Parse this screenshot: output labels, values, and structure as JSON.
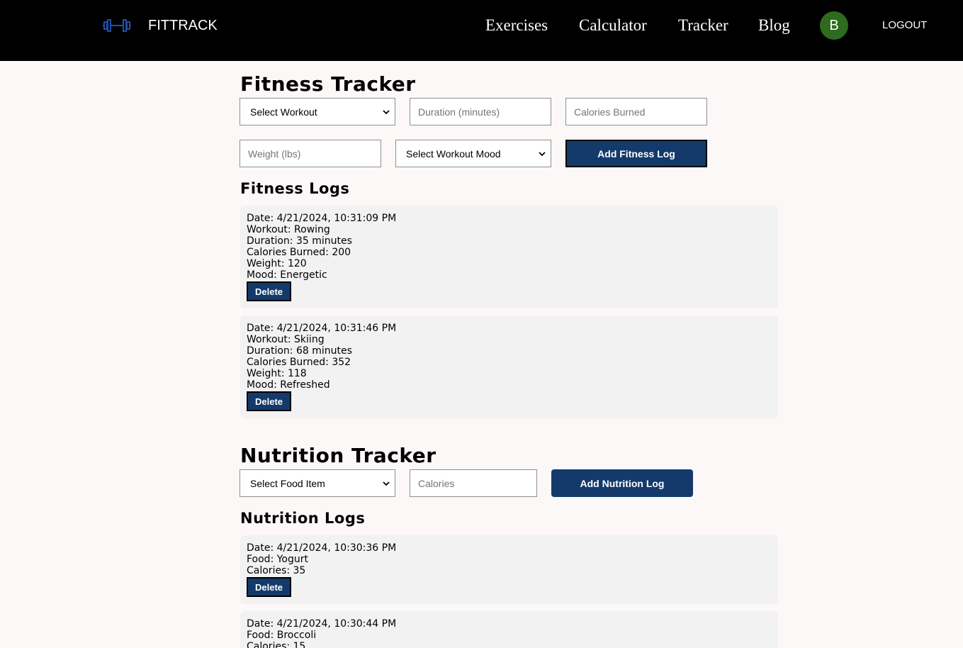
{
  "nav": {
    "brand": "FITTRACK",
    "links": [
      "Exercises",
      "Calculator",
      "Tracker",
      "Blog"
    ],
    "avatar_initial": "B",
    "logout": "LOGOUT",
    "logo_icon": "dumbbell-icon",
    "logo_color": "#1f4ea8",
    "avatar_color": "#2e6b1e"
  },
  "fitness": {
    "title": "Fitness Tracker",
    "workout_select": "Select Workout",
    "duration_placeholder": "Duration (minutes)",
    "calories_placeholder": "Calories Burned",
    "weight_placeholder": "Weight (lbs)",
    "mood_select": "Select Workout Mood",
    "add_button": "Add Fitness Log",
    "logs_title": "Fitness Logs",
    "logs": [
      {
        "date": "Date: 4/21/2024, 10:31:09 PM",
        "workout": "Workout: Rowing",
        "duration": "Duration: 35 minutes",
        "calories": "Calories Burned: 200",
        "weight": "Weight: 120",
        "mood": "Mood: Energetic"
      },
      {
        "date": "Date: 4/21/2024, 10:31:46 PM",
        "workout": "Workout: Skiing",
        "duration": "Duration: 68 minutes",
        "calories": "Calories Burned: 352",
        "weight": "Weight: 118",
        "mood": "Mood: Refreshed"
      }
    ]
  },
  "nutrition": {
    "title": "Nutrition Tracker",
    "food_select": "Select Food Item",
    "calories_placeholder": "Calories",
    "add_button": "Add Nutrition Log",
    "logs_title": "Nutrition Logs",
    "logs": [
      {
        "date": "Date: 4/21/2024, 10:30:36 PM",
        "food": "Food: Yogurt",
        "calories": "Calories: 35"
      },
      {
        "date": "Date: 4/21/2024, 10:30:44 PM",
        "food": "Food: Broccoli",
        "calories": "Calories: 15"
      }
    ]
  },
  "delete_label": "Delete",
  "colors": {
    "primary_button": "#133a6b",
    "page_background": "#fdf8f8",
    "card_background": "#f2f2f2"
  }
}
